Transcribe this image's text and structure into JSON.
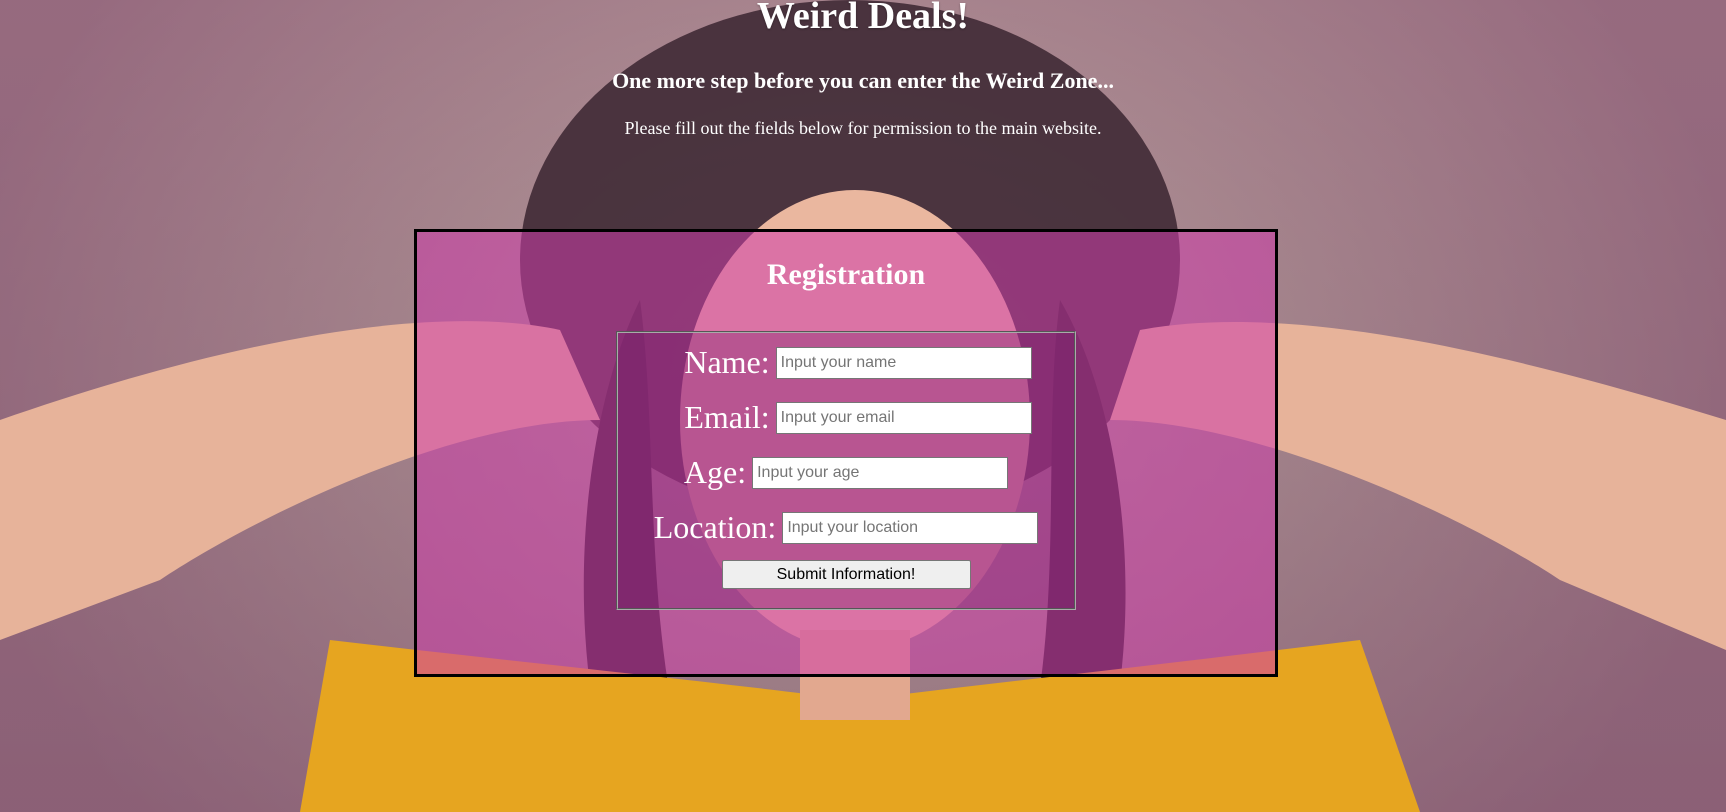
{
  "header": {
    "title": "Weird Deals!",
    "subtitle": "One more step before you can enter the Weird Zone...",
    "instructions": "Please fill out the fields below for permission to the main website."
  },
  "registration": {
    "title": "Registration",
    "fields": {
      "name": {
        "label": "Name:",
        "placeholder": "Input your name"
      },
      "email": {
        "label": "Email:",
        "placeholder": "Input your email"
      },
      "age": {
        "label": "Age:",
        "placeholder": "Input your age"
      },
      "location": {
        "label": "Location:",
        "placeholder": "Input your location"
      }
    },
    "submit_label": "Submit Information!"
  },
  "colors": {
    "panel_overlay": "#cd3caa",
    "panel_border": "#000000",
    "text": "#ffffff",
    "shirt": "#e6a520"
  },
  "background": {
    "image": "background-photo"
  }
}
